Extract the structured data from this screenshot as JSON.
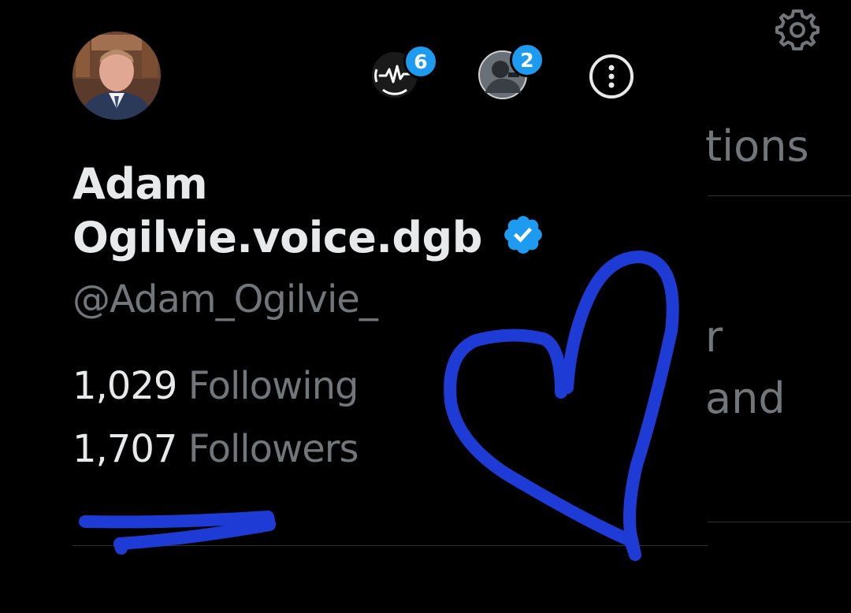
{
  "profile": {
    "name_line1": "Adam",
    "name_line2": "Ogilvie.voice.dgb",
    "handle": "@Adam_Ogilvie_",
    "verified": true,
    "following_count": "1,029",
    "following_label": "Following",
    "followers_count": "1,707",
    "followers_label": "Followers"
  },
  "header": {
    "spaces_badge": "6",
    "account_badge": "2"
  },
  "background_text": {
    "line1": "tions",
    "line2": "r",
    "line3": "and"
  },
  "colors": {
    "background": "#000000",
    "primary_text": "#e7e9ea",
    "secondary_text": "#71767b",
    "accent": "#1d9bf0",
    "annotation": "#1f3bd6"
  }
}
